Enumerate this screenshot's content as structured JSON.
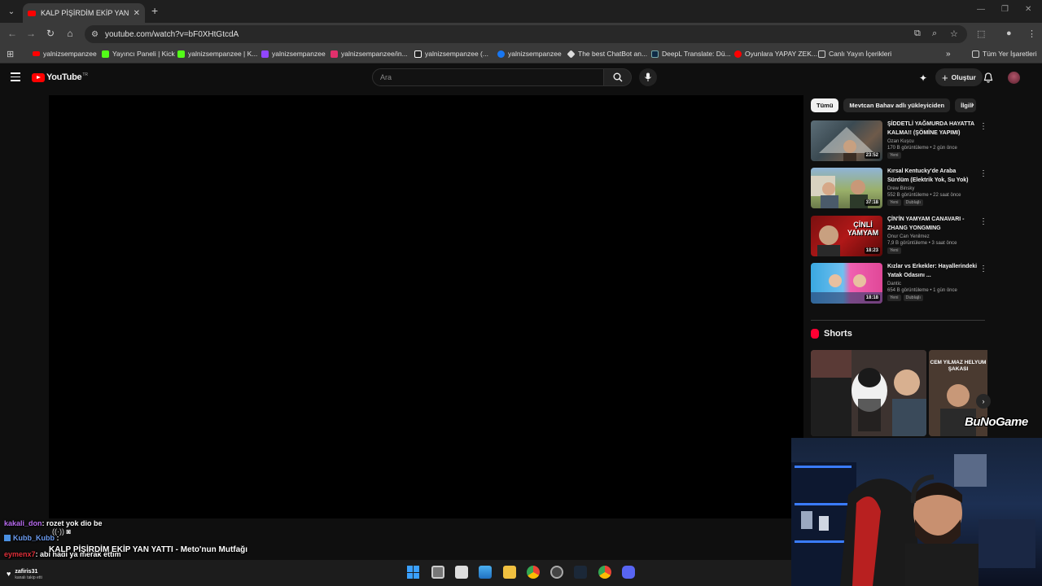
{
  "browser": {
    "tab_title": "KALP PİŞİRDİM EKİP YAN YATTI",
    "url": "youtube.com/watch?v=bF0XHtGtcdA",
    "bookmarks": [
      {
        "label": "yalnizsempanzee",
        "color": "#ff0000"
      },
      {
        "label": "Yayıncı Paneli | Kick",
        "color": "#53fc18"
      },
      {
        "label": "yalnizsempanzee | K...",
        "color": "#53fc18"
      },
      {
        "label": "yalnizsempanzee",
        "color": "#9146ff"
      },
      {
        "label": "yalnizsempanzee/in...",
        "color": "#e1306c"
      },
      {
        "label": "yalnizsempanzee (...",
        "color": "#ffffff"
      },
      {
        "label": "yalnizsempanzee",
        "color": "#1877f2"
      },
      {
        "label": "The best ChatBot an...",
        "color": "#dddddd"
      },
      {
        "label": "DeepL Translate: Dü...",
        "color": "#0f2b46"
      },
      {
        "label": "Oyunlara YAPAY ZEK...",
        "color": "#ff0000"
      },
      {
        "label": "Canlı Yayın İçerikleri",
        "color": "#cccccc"
      }
    ],
    "all_bookmarks": "Tüm Yer İşaretleri"
  },
  "youtube": {
    "logo_text": "YouTube",
    "logo_region": "TR",
    "search_placeholder": "Ara",
    "create_label": "Oluştur",
    "chips": [
      "Tümü",
      "Mevtcan Bahav adlı yükleyiciden",
      "İlgili"
    ],
    "recommendations": [
      {
        "title": "ŞİDDETLİ YAĞMURDA HAYATTA KALMA!! (ŞÖMİNE YAPIMI)",
        "channel": "Ozan Kuşcu",
        "meta": "170 B görüntüleme • 2 gün önce",
        "badges": [
          "Yeni"
        ],
        "duration": "23:52"
      },
      {
        "title": "Kırsal Kentucky'de Araba Sürdüm (Elektrik Yok, Su Yok)",
        "channel": "Drew Binsky",
        "meta": "552 B görüntüleme • 22 saat önce",
        "badges": [
          "Yeni",
          "Dublajlı"
        ],
        "duration": "37:18"
      },
      {
        "title": "ÇİN'İN YAMYAM CANAVARI - ZHANG YONGMING",
        "channel": "Onur Can Yenilmez",
        "meta": "7,9 B görüntüleme • 3 saat önce",
        "badges": [
          "Yeni"
        ],
        "duration": "18:23"
      },
      {
        "title": "Kızlar vs Erkekler: Hayallerindeki Yatak Odasını ...",
        "channel": "Dantic",
        "meta": "654 B görüntüleme • 1 gün önce",
        "badges": [
          "Yeni",
          "Dublajlı"
        ],
        "duration": "18:18"
      }
    ],
    "thumb_text_3": "ÇİNLİ YAMYAM",
    "shorts_title": "Shorts",
    "short2_caption": "CEM YILMAZ HELYUM ŞAKASI"
  },
  "overlay": {
    "brand": "BuNoGame",
    "chat": [
      {
        "user": "kakali_don",
        "text": ": rozet yok dio be",
        "color": "#b86cf0"
      },
      {
        "user": "Kubb_Kubb",
        "text": " :",
        "color": "#6c9cf0"
      },
      {
        "user": "eymenx7",
        "text": ": abi hadi ya merak ettim",
        "color": "#e0303a"
      }
    ],
    "now_playing": "KALP PİŞİRDİM EKİP YAN YATTI - Meto'nun Mutfağı",
    "follower_name": "zafiris31",
    "follower_sub": "kanalı takip etti"
  }
}
